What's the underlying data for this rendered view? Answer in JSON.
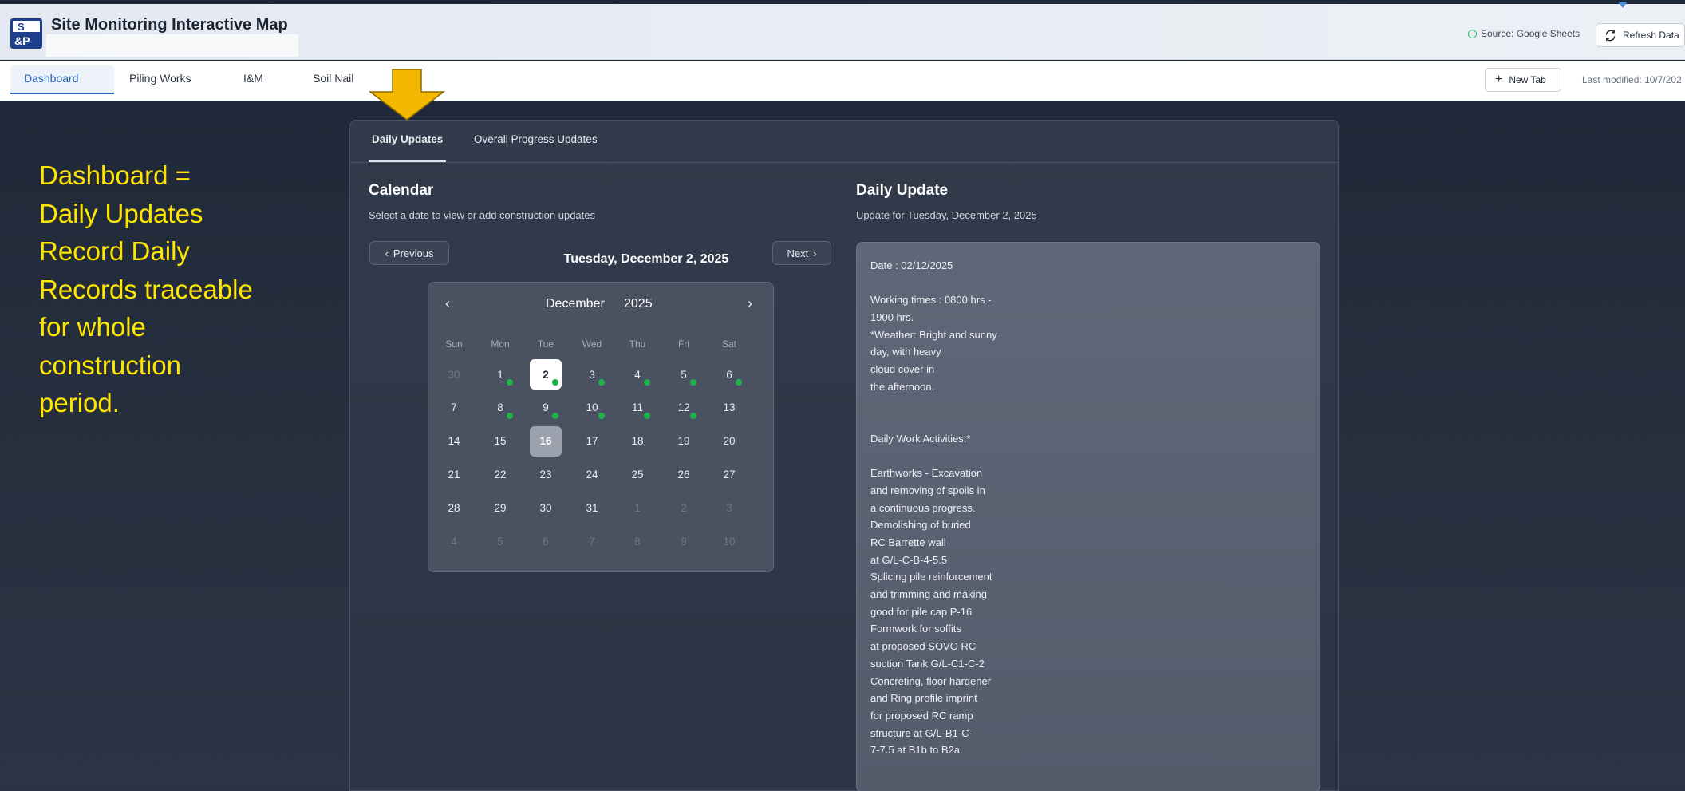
{
  "header": {
    "app_title": "Site Monitoring Interactive Map",
    "source_label": "Source: Google Sheets",
    "refresh_label": "Refresh Data"
  },
  "tabs": [
    {
      "label": "Dashboard",
      "active": true
    },
    {
      "label": "Piling Works",
      "active": false
    },
    {
      "label": "I&M",
      "active": false
    },
    {
      "label": "Soil Nail",
      "active": false
    }
  ],
  "toolbar": {
    "new_tab_label": "New Tab",
    "last_modified": "Last modified: 10/7/202"
  },
  "annotation": {
    "lines": [
      "Dashboard =",
      "Daily Updates",
      "Record Daily",
      "Records traceable",
      "for whole",
      "construction",
      "period."
    ],
    "color": "#ffe600"
  },
  "panel": {
    "tabs": [
      {
        "label": "Daily Updates",
        "active": true
      },
      {
        "label": "Overall Progress Updates",
        "active": false
      }
    ],
    "calendar_section": {
      "title": "Calendar",
      "subtitle": "Select a date to view or add construction updates",
      "prev_label": "Previous",
      "next_label": "Next",
      "selected_date_label": "Tuesday, December 2, 2025"
    },
    "calendar": {
      "month": "December",
      "year": "2025",
      "weekdays": [
        "Sun",
        "Mon",
        "Tue",
        "Wed",
        "Thu",
        "Fri",
        "Sat"
      ],
      "weeks": [
        [
          {
            "d": "30",
            "out": true
          },
          {
            "d": "1",
            "mark": true
          },
          {
            "d": "2",
            "mark": true,
            "sel": true
          },
          {
            "d": "3",
            "mark": true
          },
          {
            "d": "4",
            "mark": true
          },
          {
            "d": "5",
            "mark": true
          },
          {
            "d": "6",
            "mark": true
          }
        ],
        [
          {
            "d": "7"
          },
          {
            "d": "8",
            "mark": true
          },
          {
            "d": "9",
            "mark": true
          },
          {
            "d": "10",
            "mark": true
          },
          {
            "d": "11",
            "mark": true
          },
          {
            "d": "12",
            "mark": true
          },
          {
            "d": "13"
          }
        ],
        [
          {
            "d": "14"
          },
          {
            "d": "15"
          },
          {
            "d": "16",
            "today": true
          },
          {
            "d": "17"
          },
          {
            "d": "18"
          },
          {
            "d": "19"
          },
          {
            "d": "20"
          }
        ],
        [
          {
            "d": "21"
          },
          {
            "d": "22"
          },
          {
            "d": "23"
          },
          {
            "d": "24"
          },
          {
            "d": "25"
          },
          {
            "d": "26"
          },
          {
            "d": "27"
          }
        ],
        [
          {
            "d": "28"
          },
          {
            "d": "29"
          },
          {
            "d": "30"
          },
          {
            "d": "31"
          },
          {
            "d": "1",
            "out": true
          },
          {
            "d": "2",
            "out": true
          },
          {
            "d": "3",
            "out": true
          }
        ],
        [
          {
            "d": "4",
            "out": true
          },
          {
            "d": "5",
            "out": true
          },
          {
            "d": "6",
            "out": true
          },
          {
            "d": "7",
            "out": true
          },
          {
            "d": "8",
            "out": true
          },
          {
            "d": "9",
            "out": true
          },
          {
            "d": "10",
            "out": true
          }
        ]
      ],
      "mark_color": "#1fb24a"
    },
    "update_section": {
      "title": "Daily Update",
      "subtitle": "Update for Tuesday, December 2, 2025",
      "lines": [
        "Date : 02/12/2025",
        "",
        "Working times : 0800 hrs -",
        "1900 hrs.",
        "*Weather: Bright and sunny",
        "day, with heavy",
        "cloud cover in",
        "the afternoon.",
        "",
        "",
        "Daily Work Activities:*",
        "",
        "Earthworks - Excavation",
        "and removing of spoils in",
        "a continuous progress.",
        "Demolishing of buried",
        "RC Barrette wall",
        "at G/L-C-B-4-5.5",
        "Splicing pile reinforcement",
        "and trimming and making",
        "good for pile cap P-16",
        "Formwork for soffits",
        "at proposed SOVO RC",
        "suction Tank G/L-C1-C-2",
        "Concreting, floor hardener",
        "and Ring profile imprint",
        "for proposed RC ramp",
        "structure at G/L-B1-C-",
        "7-7.5 at B1b to B2a."
      ]
    }
  }
}
